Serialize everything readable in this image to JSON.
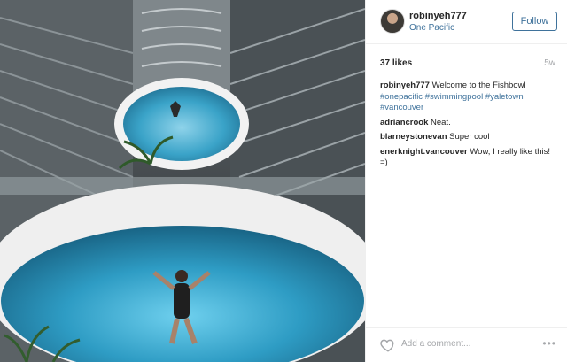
{
  "post": {
    "photo_icon": "photo",
    "user": {
      "username": "robinyeh777",
      "location": "One Pacific",
      "avatar_icon": "avatar"
    },
    "follow_label": "Follow",
    "likes": "37 likes",
    "age": "5w",
    "caption": {
      "user": "robinyeh777",
      "text": "Welcome to the Fishbowl",
      "tags": [
        "#onepacific",
        "#swimmingpool",
        "#yaletown",
        "#vancouver"
      ]
    },
    "comments": [
      {
        "user": "adriancrook",
        "text": "Neat."
      },
      {
        "user": "blarneystonevan",
        "text": "Super cool"
      },
      {
        "user": "enerknight.vancouver",
        "text": "Wow, I really like this! =)"
      }
    ],
    "add_comment_placeholder": "Add a comment...",
    "heart_icon": "heart",
    "more_icon": "ellipsis",
    "more_text": "•••"
  },
  "colors": {
    "link": "#3f729b",
    "muted": "#a5a7aa",
    "text": "#262626",
    "border": "#efefef"
  }
}
